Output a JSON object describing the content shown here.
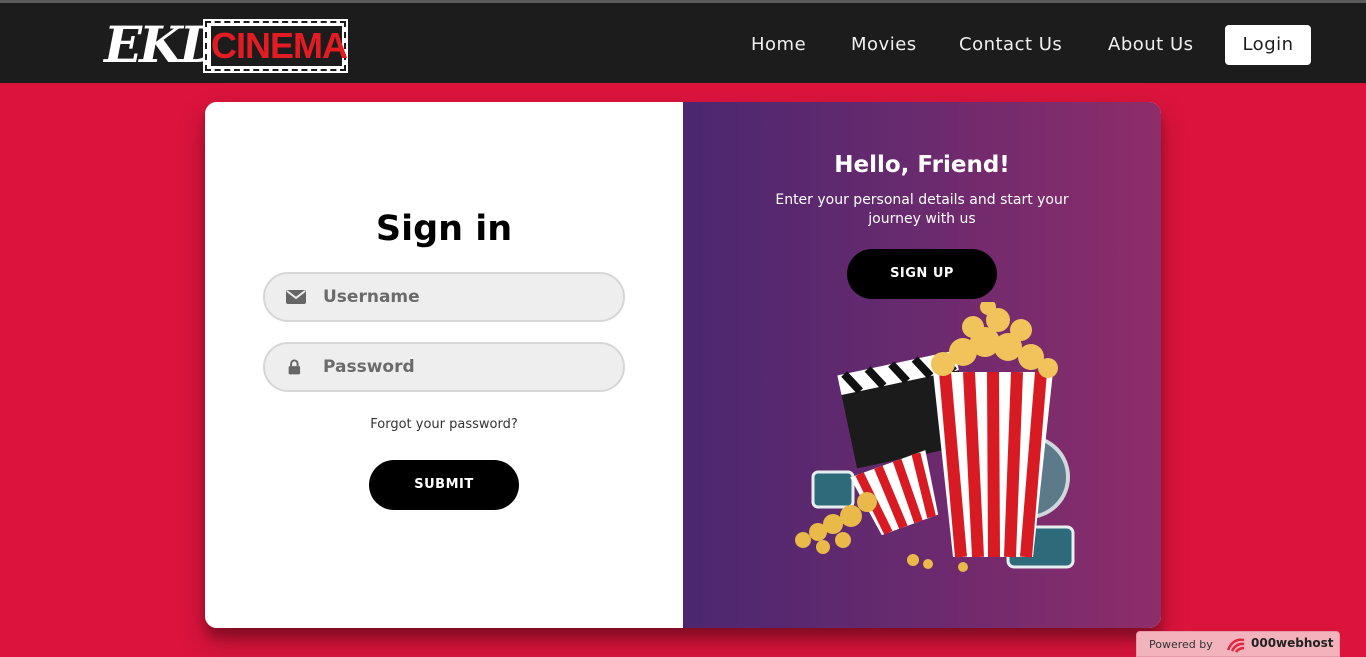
{
  "brand": {
    "logo_left": "EKD",
    "logo_right": "CINEMA"
  },
  "nav": {
    "links": [
      "Home",
      "Movies",
      "Contact Us",
      "About Us"
    ],
    "login_label": "Login"
  },
  "signin": {
    "title": "Sign in",
    "username_placeholder": "Username",
    "password_placeholder": "Password",
    "forgot_label": "Forgot your password?",
    "submit_label": "SUBMIT"
  },
  "overlay": {
    "title": "Hello, Friend!",
    "text": "Enter your personal details and start your journey with us",
    "signup_label": "SIGN UP"
  },
  "footer": {
    "powered_by": "Powered by",
    "host_brand": "000webhost"
  },
  "colors": {
    "page_bg": "#dc143c",
    "navbar_bg": "#1c1c1c",
    "gradient_start": "#4a2770",
    "gradient_end": "#8e2d6a",
    "button_bg": "#000000"
  },
  "icons": [
    "envelope-icon",
    "lock-icon",
    "popcorn-illustration",
    "000webhost-icon"
  ]
}
